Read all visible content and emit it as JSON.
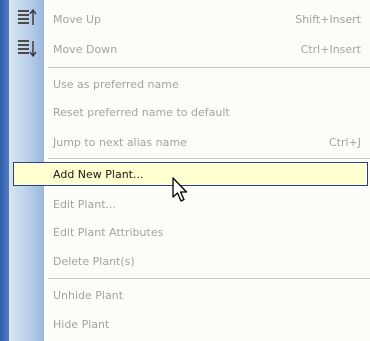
{
  "menu": {
    "items": [
      {
        "label": "Move Up",
        "shortcut": "Shift+Insert",
        "icon": "move-up-icon"
      },
      {
        "label": "Move Down",
        "shortcut": "Ctrl+Insert",
        "icon": "move-down-icon"
      },
      {
        "label": "Use as preferred name"
      },
      {
        "label": "Reset preferred name to default"
      },
      {
        "label": "Jump to next alias name",
        "shortcut": "Ctrl+J"
      },
      {
        "label": "Add New Plant...",
        "highlighted": true
      },
      {
        "label": "Edit Plant..."
      },
      {
        "label": "Edit Plant Attributes"
      },
      {
        "label": "Delete Plant(s)"
      },
      {
        "label": "Unhide Plant"
      },
      {
        "label": "Hide Plant"
      }
    ]
  },
  "colors": {
    "highlight_bg": "#ffffd0",
    "highlight_border": "#25408f",
    "disabled_text": "#a3a3a3",
    "gutter": "#c2d5ec"
  },
  "cursor": "arrow-cursor-icon"
}
